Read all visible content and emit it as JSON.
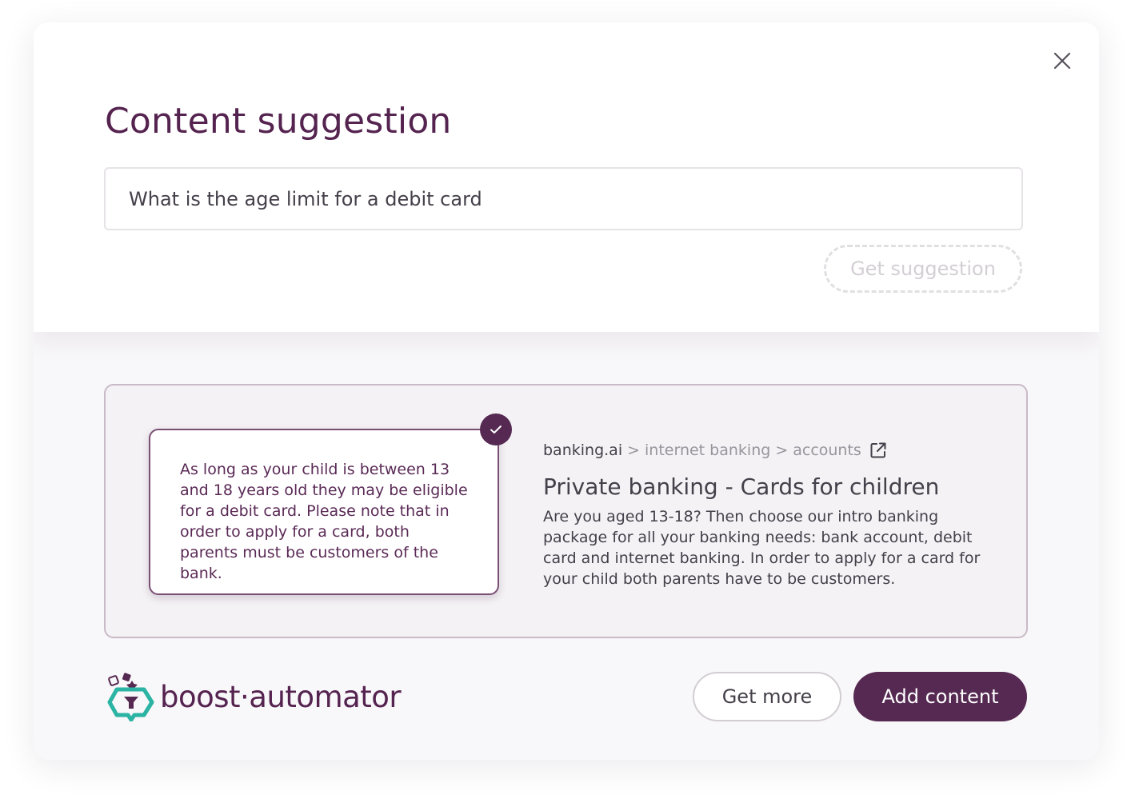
{
  "dialog": {
    "title": "Content suggestion",
    "close_icon": "close-icon"
  },
  "query": {
    "value": "What is the age limit for a debit card",
    "placeholder": ""
  },
  "get_suggestion": {
    "label": "Get suggestion"
  },
  "result": {
    "answer": "As long as your child is between 13 and 18 years old they may be eligible for a debit card. Please note that in order to apply for a card, both parents must be customers of the bank.",
    "selected_icon": "check-icon",
    "source": {
      "breadcrumb": [
        "banking.ai",
        "internet banking",
        "accounts"
      ],
      "separator": ">",
      "link_icon": "external-link-icon",
      "title": "Private banking - Cards for children",
      "description": "Are you aged 13-18? Then choose our intro banking package for all your banking needs: bank account, debit card and internet banking. In order to apply for a card for your child both parents have to be customers."
    }
  },
  "footer": {
    "logo_text": "boost·automator",
    "get_more_label": "Get more",
    "add_content_label": "Add content"
  },
  "colors": {
    "brand": "#562952",
    "title": "#55234f",
    "logo_accent": "#2bb3a3",
    "panel_border": "#c9bac7"
  }
}
